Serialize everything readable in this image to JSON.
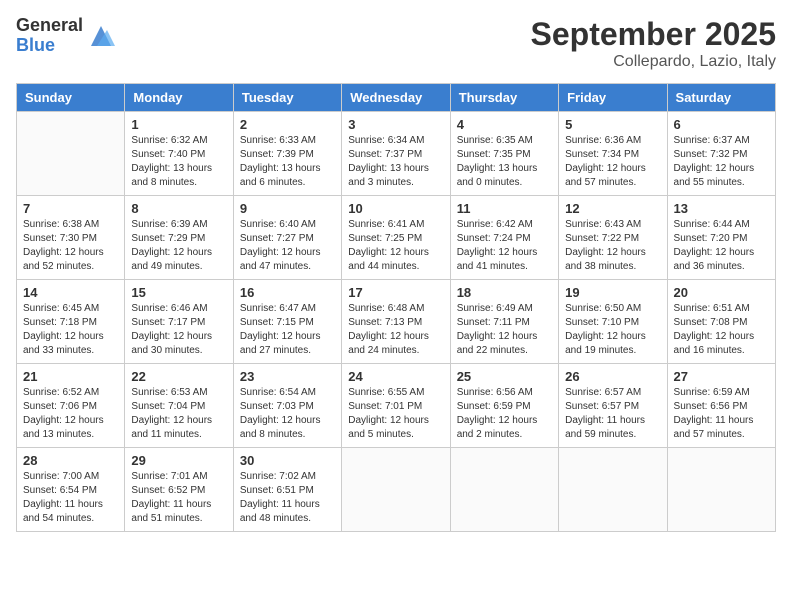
{
  "logo": {
    "general": "General",
    "blue": "Blue"
  },
  "title": "September 2025",
  "location": "Collepardo, Lazio, Italy",
  "weekdays": [
    "Sunday",
    "Monday",
    "Tuesday",
    "Wednesday",
    "Thursday",
    "Friday",
    "Saturday"
  ],
  "weeks": [
    [
      {
        "day": "",
        "sunrise": "",
        "sunset": "",
        "daylight": ""
      },
      {
        "day": "1",
        "sunrise": "Sunrise: 6:32 AM",
        "sunset": "Sunset: 7:40 PM",
        "daylight": "Daylight: 13 hours and 8 minutes."
      },
      {
        "day": "2",
        "sunrise": "Sunrise: 6:33 AM",
        "sunset": "Sunset: 7:39 PM",
        "daylight": "Daylight: 13 hours and 6 minutes."
      },
      {
        "day": "3",
        "sunrise": "Sunrise: 6:34 AM",
        "sunset": "Sunset: 7:37 PM",
        "daylight": "Daylight: 13 hours and 3 minutes."
      },
      {
        "day": "4",
        "sunrise": "Sunrise: 6:35 AM",
        "sunset": "Sunset: 7:35 PM",
        "daylight": "Daylight: 13 hours and 0 minutes."
      },
      {
        "day": "5",
        "sunrise": "Sunrise: 6:36 AM",
        "sunset": "Sunset: 7:34 PM",
        "daylight": "Daylight: 12 hours and 57 minutes."
      },
      {
        "day": "6",
        "sunrise": "Sunrise: 6:37 AM",
        "sunset": "Sunset: 7:32 PM",
        "daylight": "Daylight: 12 hours and 55 minutes."
      }
    ],
    [
      {
        "day": "7",
        "sunrise": "Sunrise: 6:38 AM",
        "sunset": "Sunset: 7:30 PM",
        "daylight": "Daylight: 12 hours and 52 minutes."
      },
      {
        "day": "8",
        "sunrise": "Sunrise: 6:39 AM",
        "sunset": "Sunset: 7:29 PM",
        "daylight": "Daylight: 12 hours and 49 minutes."
      },
      {
        "day": "9",
        "sunrise": "Sunrise: 6:40 AM",
        "sunset": "Sunset: 7:27 PM",
        "daylight": "Daylight: 12 hours and 47 minutes."
      },
      {
        "day": "10",
        "sunrise": "Sunrise: 6:41 AM",
        "sunset": "Sunset: 7:25 PM",
        "daylight": "Daylight: 12 hours and 44 minutes."
      },
      {
        "day": "11",
        "sunrise": "Sunrise: 6:42 AM",
        "sunset": "Sunset: 7:24 PM",
        "daylight": "Daylight: 12 hours and 41 minutes."
      },
      {
        "day": "12",
        "sunrise": "Sunrise: 6:43 AM",
        "sunset": "Sunset: 7:22 PM",
        "daylight": "Daylight: 12 hours and 38 minutes."
      },
      {
        "day": "13",
        "sunrise": "Sunrise: 6:44 AM",
        "sunset": "Sunset: 7:20 PM",
        "daylight": "Daylight: 12 hours and 36 minutes."
      }
    ],
    [
      {
        "day": "14",
        "sunrise": "Sunrise: 6:45 AM",
        "sunset": "Sunset: 7:18 PM",
        "daylight": "Daylight: 12 hours and 33 minutes."
      },
      {
        "day": "15",
        "sunrise": "Sunrise: 6:46 AM",
        "sunset": "Sunset: 7:17 PM",
        "daylight": "Daylight: 12 hours and 30 minutes."
      },
      {
        "day": "16",
        "sunrise": "Sunrise: 6:47 AM",
        "sunset": "Sunset: 7:15 PM",
        "daylight": "Daylight: 12 hours and 27 minutes."
      },
      {
        "day": "17",
        "sunrise": "Sunrise: 6:48 AM",
        "sunset": "Sunset: 7:13 PM",
        "daylight": "Daylight: 12 hours and 24 minutes."
      },
      {
        "day": "18",
        "sunrise": "Sunrise: 6:49 AM",
        "sunset": "Sunset: 7:11 PM",
        "daylight": "Daylight: 12 hours and 22 minutes."
      },
      {
        "day": "19",
        "sunrise": "Sunrise: 6:50 AM",
        "sunset": "Sunset: 7:10 PM",
        "daylight": "Daylight: 12 hours and 19 minutes."
      },
      {
        "day": "20",
        "sunrise": "Sunrise: 6:51 AM",
        "sunset": "Sunset: 7:08 PM",
        "daylight": "Daylight: 12 hours and 16 minutes."
      }
    ],
    [
      {
        "day": "21",
        "sunrise": "Sunrise: 6:52 AM",
        "sunset": "Sunset: 7:06 PM",
        "daylight": "Daylight: 12 hours and 13 minutes."
      },
      {
        "day": "22",
        "sunrise": "Sunrise: 6:53 AM",
        "sunset": "Sunset: 7:04 PM",
        "daylight": "Daylight: 12 hours and 11 minutes."
      },
      {
        "day": "23",
        "sunrise": "Sunrise: 6:54 AM",
        "sunset": "Sunset: 7:03 PM",
        "daylight": "Daylight: 12 hours and 8 minutes."
      },
      {
        "day": "24",
        "sunrise": "Sunrise: 6:55 AM",
        "sunset": "Sunset: 7:01 PM",
        "daylight": "Daylight: 12 hours and 5 minutes."
      },
      {
        "day": "25",
        "sunrise": "Sunrise: 6:56 AM",
        "sunset": "Sunset: 6:59 PM",
        "daylight": "Daylight: 12 hours and 2 minutes."
      },
      {
        "day": "26",
        "sunrise": "Sunrise: 6:57 AM",
        "sunset": "Sunset: 6:57 PM",
        "daylight": "Daylight: 11 hours and 59 minutes."
      },
      {
        "day": "27",
        "sunrise": "Sunrise: 6:59 AM",
        "sunset": "Sunset: 6:56 PM",
        "daylight": "Daylight: 11 hours and 57 minutes."
      }
    ],
    [
      {
        "day": "28",
        "sunrise": "Sunrise: 7:00 AM",
        "sunset": "Sunset: 6:54 PM",
        "daylight": "Daylight: 11 hours and 54 minutes."
      },
      {
        "day": "29",
        "sunrise": "Sunrise: 7:01 AM",
        "sunset": "Sunset: 6:52 PM",
        "daylight": "Daylight: 11 hours and 51 minutes."
      },
      {
        "day": "30",
        "sunrise": "Sunrise: 7:02 AM",
        "sunset": "Sunset: 6:51 PM",
        "daylight": "Daylight: 11 hours and 48 minutes."
      },
      {
        "day": "",
        "sunrise": "",
        "sunset": "",
        "daylight": ""
      },
      {
        "day": "",
        "sunrise": "",
        "sunset": "",
        "daylight": ""
      },
      {
        "day": "",
        "sunrise": "",
        "sunset": "",
        "daylight": ""
      },
      {
        "day": "",
        "sunrise": "",
        "sunset": "",
        "daylight": ""
      }
    ]
  ]
}
